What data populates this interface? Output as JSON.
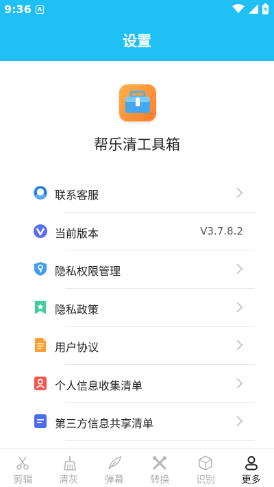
{
  "status_bar": {
    "time": "9:36",
    "notification_icon": "A"
  },
  "header": {
    "title": "设置"
  },
  "app": {
    "name": "帮乐清工具箱",
    "icon": "toolbox-icon"
  },
  "menu": [
    {
      "label": "联系客服",
      "icon": "customer-service-icon",
      "value": "",
      "chevron": true
    },
    {
      "label": "当前版本",
      "icon": "version-v-icon",
      "value": "V3.7.8.2",
      "chevron": false
    },
    {
      "label": "隐私权限管理",
      "icon": "shield-key-icon",
      "value": "",
      "chevron": true
    },
    {
      "label": "隐私政策",
      "icon": "bookmark-star-icon",
      "value": "",
      "chevron": true
    },
    {
      "label": "用户协议",
      "icon": "document-icon",
      "value": "",
      "chevron": true
    },
    {
      "label": "个人信息收集清单",
      "icon": "person-card-icon",
      "value": "",
      "chevron": true
    },
    {
      "label": "第三方信息共享清单",
      "icon": "list-card-icon",
      "value": "",
      "chevron": true
    }
  ],
  "tabs": [
    {
      "label": "剪辑",
      "icon": "scissors-icon",
      "active": false
    },
    {
      "label": "清灰",
      "icon": "broom-icon",
      "active": false
    },
    {
      "label": "弹幕",
      "icon": "feather-icon",
      "active": false
    },
    {
      "label": "转换",
      "icon": "tools-icon",
      "active": false
    },
    {
      "label": "识别",
      "icon": "cube-icon",
      "active": false
    },
    {
      "label": "更多",
      "icon": "person-icon",
      "active": true
    }
  ],
  "colors": {
    "header_bg": "#1ec0f6",
    "tab_active": "#222222",
    "tab_inactive": "#aaaaaa"
  }
}
